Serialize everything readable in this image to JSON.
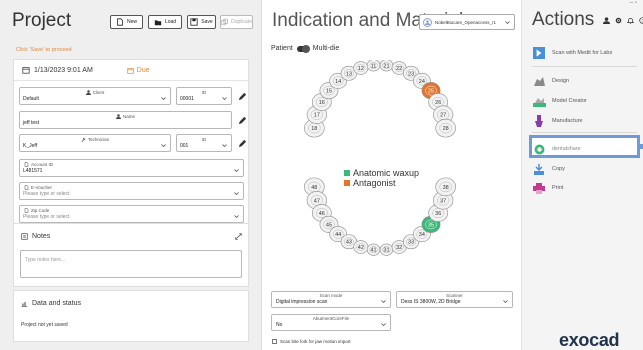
{
  "project": {
    "title": "Project",
    "buttons": {
      "new": "New",
      "load": "Load",
      "save": "Save",
      "duplicate": "Duplicate"
    },
    "hint": "Click 'Save' to proceed",
    "date": "1/13/2023 9:01 AM",
    "due": "Due",
    "client": {
      "label": "Client",
      "value": "Default"
    },
    "client_id": {
      "label": "ID",
      "value": "00001"
    },
    "name": {
      "label": "Name",
      "value": "jeff test"
    },
    "technician": {
      "label": "Technician",
      "value": "K_Jeff"
    },
    "technician_id": {
      "label": "ID",
      "value": "001"
    },
    "account_id": {
      "label": "Account ID",
      "value": "L481571"
    },
    "evoucher": {
      "label": "E-Voucher",
      "placeholder": "Please type or select"
    },
    "zip": {
      "label": "Zip Code",
      "placeholder": "Please type or select"
    },
    "notes": {
      "title": "Notes",
      "placeholder": "Type notes here..."
    },
    "data_status": {
      "title": "Data and status",
      "status": "Project not yet saved"
    }
  },
  "indication": {
    "title": "Indication and Materials",
    "profile": "NobelBiocare_Openaccess_r1",
    "toggle_left": "Patient",
    "toggle_right": "Multi-die",
    "teeth_upper": [
      "18",
      "17",
      "16",
      "15",
      "14",
      "13",
      "12",
      "11",
      "21",
      "22",
      "23",
      "24",
      "25",
      "26",
      "27",
      "28"
    ],
    "teeth_lower": [
      "48",
      "47",
      "46",
      "45",
      "44",
      "43",
      "42",
      "41",
      "31",
      "32",
      "33",
      "34",
      "35",
      "36",
      "37",
      "38"
    ],
    "legend": [
      {
        "label": "Anatomic waxup",
        "color": "#3cb878"
      },
      {
        "label": "Antagonist",
        "color": "#e5752a"
      }
    ],
    "scan_mode": {
      "label": "Scan mode",
      "value": "Digital impression scan"
    },
    "scanner": {
      "label": "Scanner",
      "value": "Dess IS 3800W, 2D Bridge"
    },
    "abutment_file": {
      "label": "AbutmentCoreFile",
      "value": "No"
    },
    "checkbox_label": "Scan bite fork for jaw motion import"
  },
  "actions": {
    "title": "Actions",
    "window_controls": "– ▫",
    "items": [
      {
        "label": "Scan with Medit for Labs"
      },
      {
        "label": "Design"
      },
      {
        "label": "Model Creator"
      },
      {
        "label": "Manufacture"
      },
      {
        "label": "dentalshare"
      },
      {
        "label": "Copy"
      },
      {
        "label": "Print"
      }
    ],
    "brand": "exocad"
  },
  "colors": {
    "accent": "#6f9ad8",
    "warning": "#e08a3c",
    "wax": "#3cb878",
    "antagonist": "#e5752a"
  }
}
